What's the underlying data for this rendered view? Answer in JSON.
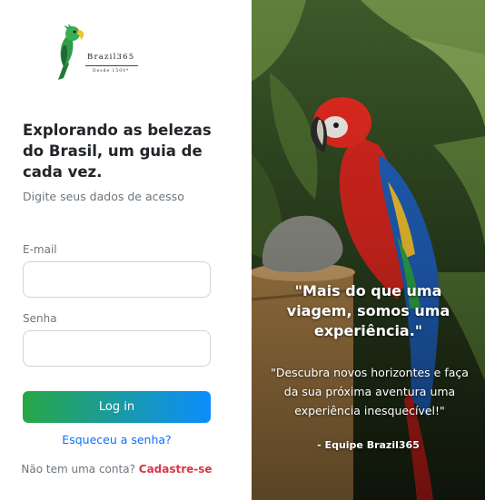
{
  "brand": {
    "name": "Brazil365",
    "tagline": "Desde 1500*"
  },
  "login": {
    "headline": "Explorando as belezas do Brasil, um guia de cada vez.",
    "subtitle": "Digite seus dados de acesso",
    "email_label": "E-mail",
    "email_value": "",
    "password_label": "Senha",
    "password_value": "",
    "submit_label": "Log in",
    "forgot_label": "Esqueceu a senha?",
    "no_account_text": "Não tem uma conta?",
    "signup_label": "Cadastre-se"
  },
  "hero": {
    "quote_title": "\"Mais do que uma viagem, somos uma experiência.\"",
    "quote_text": "\"Descubra novos horizontes e faça da sua próxima aventura uma experiência inesquecível!\"",
    "author": "- Equipe Brazil365"
  },
  "colors": {
    "button_gradient_start": "#28a745",
    "button_gradient_end": "#0b8dff",
    "link": "#0d6efd",
    "signup_link": "#dc3545"
  },
  "icons": {
    "logo": "parrot-logo-icon",
    "hero": "macaw-photo"
  }
}
